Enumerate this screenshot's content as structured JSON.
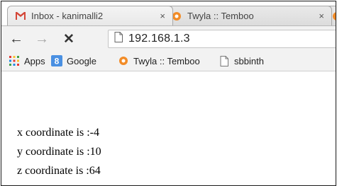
{
  "tabs": [
    {
      "title": "Inbox - kanimalli2",
      "favicon": "gmail-icon",
      "close": "×"
    },
    {
      "title": "Twyla :: Temboo",
      "favicon": "temboo-icon",
      "close": "×"
    }
  ],
  "toolbar": {
    "back": "←",
    "forward": "→",
    "reload": "✕",
    "url": "192.168.1.3"
  },
  "bookmarks": [
    {
      "label": "Apps",
      "icon": "apps-grid-icon"
    },
    {
      "label": "Google",
      "icon": "google-icon"
    },
    {
      "label": "Twyla :: Temboo",
      "icon": "temboo-icon"
    },
    {
      "label": "sbbinth",
      "icon": "page-icon"
    }
  ],
  "page": {
    "lines": [
      "x coordinate is :-4",
      "y coordinate is :10",
      "z coordinate is :64"
    ]
  },
  "colors": {
    "gmail_red": "#d44638",
    "temboo_orange": "#f28c28",
    "google_blue": "#4a90e2"
  }
}
